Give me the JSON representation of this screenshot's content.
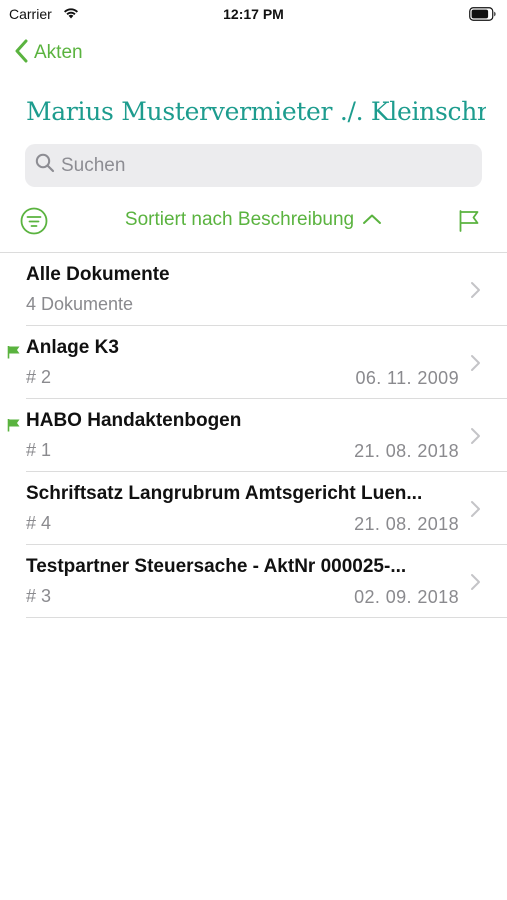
{
  "status": {
    "carrier": "Carrier",
    "time": "12:17 PM"
  },
  "nav": {
    "back_label": "Akten",
    "title": "Marius Mustervermieter ./. Kleinschr…"
  },
  "search": {
    "placeholder": "Suchen",
    "value": ""
  },
  "sort": {
    "label": "Sortiert nach Beschreibung"
  },
  "colors": {
    "accent": "#5ab33f",
    "title": "#1d9c8e",
    "secondary_text": "#8a8a8e"
  },
  "icons": {
    "filter": "filter-circle-icon",
    "sort_direction": "chevron-up-icon",
    "flag": "flag-outline-icon",
    "row_flag": "flag-filled-icon",
    "disclosure": "chevron-right-icon"
  },
  "documents": [
    {
      "title": "Alle Dokumente",
      "subtitle": "4 Dokumente",
      "date": "",
      "flagged": false
    },
    {
      "title": "Anlage K3",
      "subtitle": "# 2",
      "date": "06. 11. 2009",
      "flagged": true
    },
    {
      "title": "HABO Handaktenbogen",
      "subtitle": "# 1",
      "date": "21. 08. 2018",
      "flagged": true
    },
    {
      "title": "Schriftsatz Langrubrum Amtsgericht Luen...",
      "subtitle": "# 4",
      "date": "21. 08. 2018",
      "flagged": false
    },
    {
      "title": "Testpartner Steuersache - AktNr 000025-...",
      "subtitle": "# 3",
      "date": "02. 09. 2018",
      "flagged": false
    }
  ]
}
